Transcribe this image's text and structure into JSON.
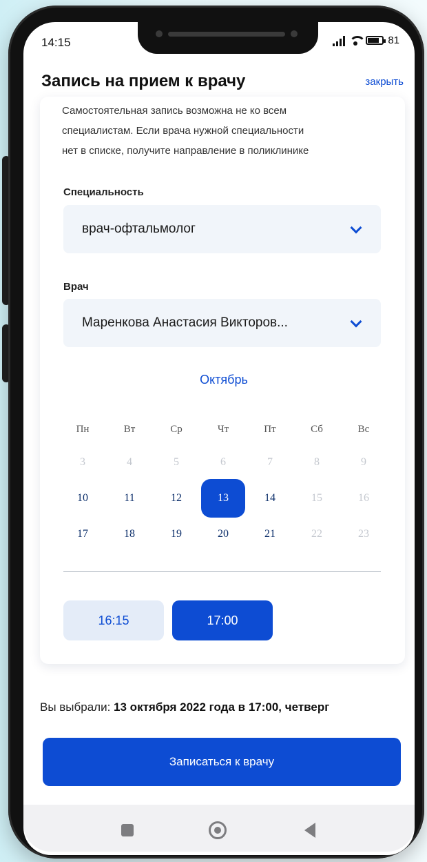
{
  "status": {
    "time": "14:15",
    "battery": "81"
  },
  "header": {
    "title": "Запись на прием к врачу",
    "close_label": "закрыть"
  },
  "notice": {
    "lines": [
      "Самостоятельная запись возможна не ко всем",
      "специалистам. Если врача нужной специальности",
      "нет в списке, получите направление в поликлинике"
    ]
  },
  "specialty": {
    "label": "Специальность",
    "value": "врач-офтальмолог"
  },
  "doctor": {
    "label": "Врач",
    "value": "Маренкова Анастасия Викторов..."
  },
  "calendar": {
    "month": "Октябрь",
    "weekdays": [
      "Пн",
      "Вт",
      "Ср",
      "Чт",
      "Пт",
      "Сб",
      "Вс"
    ],
    "weeks": [
      [
        {
          "d": "3",
          "s": "disabled"
        },
        {
          "d": "4",
          "s": "disabled"
        },
        {
          "d": "5",
          "s": "disabled"
        },
        {
          "d": "6",
          "s": "disabled"
        },
        {
          "d": "7",
          "s": "disabled"
        },
        {
          "d": "8",
          "s": "disabled"
        },
        {
          "d": "9",
          "s": "disabled"
        }
      ],
      [
        {
          "d": "10",
          "s": "active"
        },
        {
          "d": "11",
          "s": "active"
        },
        {
          "d": "12",
          "s": "active"
        },
        {
          "d": "13",
          "s": "selected"
        },
        {
          "d": "14",
          "s": "active"
        },
        {
          "d": "15",
          "s": "disabled"
        },
        {
          "d": "16",
          "s": "disabled"
        }
      ],
      [
        {
          "d": "17",
          "s": "active"
        },
        {
          "d": "18",
          "s": "active"
        },
        {
          "d": "19",
          "s": "active"
        },
        {
          "d": "20",
          "s": "active"
        },
        {
          "d": "21",
          "s": "active"
        },
        {
          "d": "22",
          "s": "disabled"
        },
        {
          "d": "23",
          "s": "disabled"
        }
      ]
    ]
  },
  "times": [
    {
      "label": "16:15",
      "selected": false
    },
    {
      "label": "17:00",
      "selected": true
    }
  ],
  "summary": {
    "prefix": "Вы выбрали: ",
    "value": "13 октября 2022 года в 17:00, четверг"
  },
  "submit_label": "Записаться к врачу",
  "colors": {
    "accent": "#0d4cd3",
    "field_bg": "#f1f5fa",
    "disabled_text": "#c4c8cf"
  }
}
